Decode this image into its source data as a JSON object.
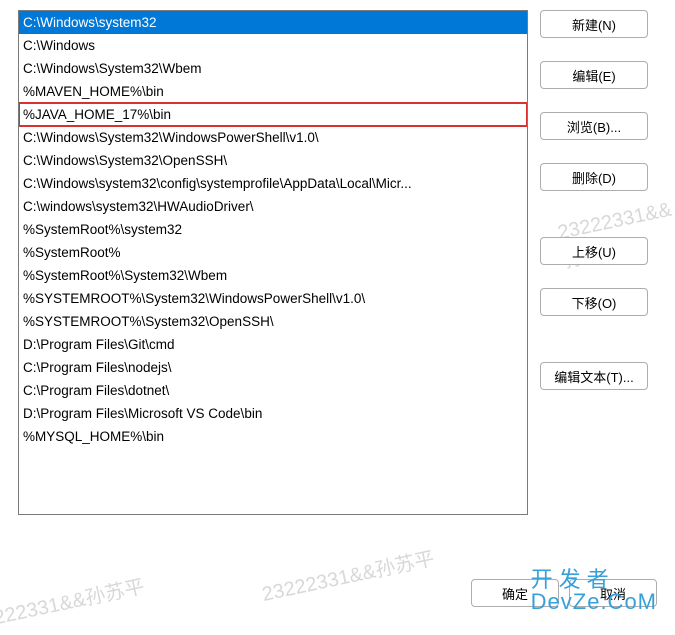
{
  "list": {
    "items": [
      "C:\\Windows\\system32",
      "C:\\Windows",
      "C:\\Windows\\System32\\Wbem",
      "%MAVEN_HOME%\\bin",
      "%JAVA_HOME_17%\\bin",
      "C:\\Windows\\System32\\WindowsPowerShell\\v1.0\\",
      "C:\\Windows\\System32\\OpenSSH\\",
      "C:\\Windows\\system32\\config\\systemprofile\\AppData\\Local\\Micr...",
      "C:\\windows\\system32\\HWAudioDriver\\",
      "%SystemRoot%\\system32",
      "%SystemRoot%",
      "%SystemRoot%\\System32\\Wbem",
      "%SYSTEMROOT%\\System32\\WindowsPowerShell\\v1.0\\",
      "%SYSTEMROOT%\\System32\\OpenSSH\\",
      "D:\\Program Files\\Git\\cmd",
      "C:\\Program Files\\nodejs\\",
      "C:\\Program Files\\dotnet\\",
      "D:\\Program Files\\Microsoft VS Code\\bin",
      "%MYSQL_HOME%\\bin"
    ],
    "selectedIndex": 0,
    "highlightedIndex": 4
  },
  "buttons": {
    "new": "新建(N)",
    "edit": "编辑(E)",
    "browse": "浏览(B)...",
    "delete": "删除(D)",
    "moveUp": "上移(U)",
    "moveDown": "下移(O)",
    "editText": "编辑文本(T)..."
  },
  "footer": {
    "ok": "确定",
    "cancel": "取消"
  },
  "watermark": "23222331&&孙苏平",
  "logo": {
    "line1": "开发者",
    "line2": "DevZe.CoM"
  }
}
